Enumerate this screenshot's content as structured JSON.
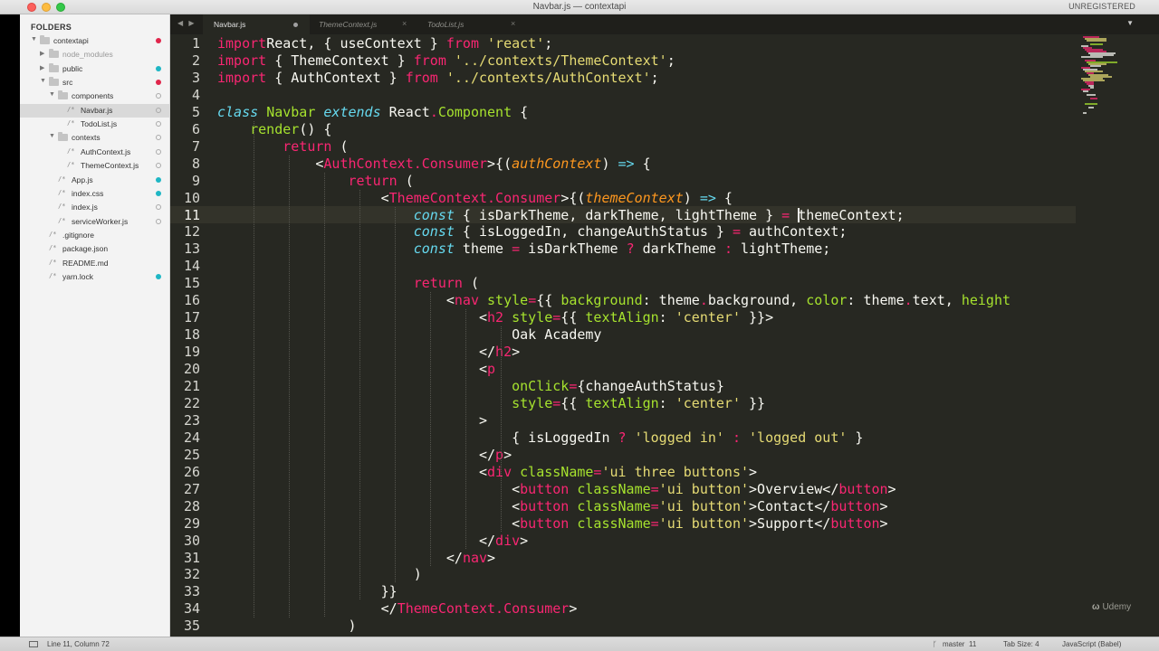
{
  "window": {
    "title": "Navbar.js — contextapi",
    "license_status": "UNREGISTERED"
  },
  "sidebar": {
    "heading": "FOLDERS",
    "items": [
      {
        "label": "contextapi",
        "type": "folder",
        "depth": 0,
        "status": "modified"
      },
      {
        "label": "node_modules",
        "type": "folder",
        "depth": 1,
        "status": "none",
        "muted": true
      },
      {
        "label": "public",
        "type": "folder",
        "depth": 1,
        "status": "new"
      },
      {
        "label": "src",
        "type": "folder",
        "depth": 1,
        "status": "modified"
      },
      {
        "label": "components",
        "type": "folder",
        "depth": 2,
        "status": "unchanged"
      },
      {
        "label": "Navbar.js",
        "type": "file",
        "depth": 3,
        "status": "unchanged",
        "selected": true
      },
      {
        "label": "TodoList.js",
        "type": "file",
        "depth": 3,
        "status": "unchanged"
      },
      {
        "label": "contexts",
        "type": "folder",
        "depth": 2,
        "status": "unchanged"
      },
      {
        "label": "AuthContext.js",
        "type": "file",
        "depth": 3,
        "status": "unchanged"
      },
      {
        "label": "ThemeContext.js",
        "type": "file",
        "depth": 3,
        "status": "unchanged"
      },
      {
        "label": "App.js",
        "type": "file",
        "depth": 2,
        "status": "new"
      },
      {
        "label": "index.css",
        "type": "file",
        "depth": 2,
        "status": "new"
      },
      {
        "label": "index.js",
        "type": "file",
        "depth": 2,
        "status": "unchanged"
      },
      {
        "label": "serviceWorker.js",
        "type": "file",
        "depth": 2,
        "status": "unchanged"
      },
      {
        "label": ".gitignore",
        "type": "file",
        "depth": 1,
        "status": "none"
      },
      {
        "label": "package.json",
        "type": "file",
        "depth": 1,
        "status": "none"
      },
      {
        "label": "README.md",
        "type": "file",
        "depth": 1,
        "status": "none"
      },
      {
        "label": "yarn.lock",
        "type": "file",
        "depth": 1,
        "status": "new"
      }
    ]
  },
  "tabs": [
    {
      "label": "Navbar.js",
      "active": true,
      "dirty": true,
      "close": "×"
    },
    {
      "label": "ThemeContext.js",
      "active": false,
      "dirty": false,
      "close": "×"
    },
    {
      "label": "TodoList.js",
      "active": false,
      "dirty": false,
      "close": "×"
    }
  ],
  "tab_nav": "◀ ▶",
  "tab_menu": "▼",
  "editor": {
    "current_line": 11,
    "lines": [
      {
        "n": "1",
        "segs": [
          [
            "kw",
            "import"
          ],
          [
            "",
            "React, { useContext } "
          ],
          [
            "kw",
            "from"
          ],
          [
            "",
            " "
          ],
          [
            "st",
            "'react'"
          ],
          [
            "",
            ";"
          ]
        ]
      },
      {
        "n": "2",
        "segs": [
          [
            "kw",
            "import"
          ],
          [
            "",
            " { ThemeContext } "
          ],
          [
            "kw",
            "from"
          ],
          [
            "",
            " "
          ],
          [
            "st",
            "'../contexts/ThemeContext'"
          ],
          [
            "",
            ";"
          ]
        ]
      },
      {
        "n": "3",
        "segs": [
          [
            "kw",
            "import"
          ],
          [
            "",
            " { AuthContext } "
          ],
          [
            "kw",
            "from"
          ],
          [
            "",
            " "
          ],
          [
            "st",
            "'../contexts/AuthContext'"
          ],
          [
            "",
            ";"
          ]
        ]
      },
      {
        "n": "4",
        "segs": []
      },
      {
        "n": "5",
        "segs": [
          [
            "kw2",
            "class"
          ],
          [
            "",
            " "
          ],
          [
            "ty",
            "Navbar"
          ],
          [
            "",
            " "
          ],
          [
            "kw2",
            "extends"
          ],
          [
            "",
            " React"
          ],
          [
            "op",
            "."
          ],
          [
            "ty",
            "Component"
          ],
          [
            "",
            " {"
          ]
        ]
      },
      {
        "n": "6",
        "segs": [
          [
            "",
            "    "
          ],
          [
            "fn",
            "render"
          ],
          [
            "",
            "() {"
          ]
        ]
      },
      {
        "n": "7",
        "segs": [
          [
            "",
            "        "
          ],
          [
            "kw",
            "return"
          ],
          [
            "",
            " ("
          ]
        ]
      },
      {
        "n": "8",
        "segs": [
          [
            "",
            "            <"
          ],
          [
            "tag",
            "AuthContext.Consumer"
          ],
          [
            "",
            ">{("
          ],
          [
            "par",
            "authContext"
          ],
          [
            "",
            ") "
          ],
          [
            "kw2",
            "=>"
          ],
          [
            "",
            " {"
          ]
        ]
      },
      {
        "n": "9",
        "segs": [
          [
            "",
            "                "
          ],
          [
            "kw",
            "return"
          ],
          [
            "",
            " ("
          ]
        ]
      },
      {
        "n": "10",
        "segs": [
          [
            "",
            "                    <"
          ],
          [
            "tag",
            "ThemeContext.Consumer"
          ],
          [
            "",
            ">{("
          ],
          [
            "par",
            "themeContext"
          ],
          [
            "",
            ") "
          ],
          [
            "kw2",
            "=>"
          ],
          [
            "",
            " {"
          ]
        ]
      },
      {
        "n": "11",
        "segs": [
          [
            "",
            "                        "
          ],
          [
            "kw2",
            "const"
          ],
          [
            "",
            " { isDarkTheme, darkTheme, lightTheme } "
          ],
          [
            "op",
            "="
          ],
          [
            "",
            " "
          ],
          [
            "caret",
            ""
          ],
          [
            "",
            "themeContext;"
          ]
        ]
      },
      {
        "n": "12",
        "segs": [
          [
            "",
            "                        "
          ],
          [
            "kw2",
            "const"
          ],
          [
            "",
            " { isLoggedIn, changeAuthStatus } "
          ],
          [
            "op",
            "="
          ],
          [
            "",
            " authContext;"
          ]
        ]
      },
      {
        "n": "13",
        "segs": [
          [
            "",
            "                        "
          ],
          [
            "kw2",
            "const"
          ],
          [
            "",
            " theme "
          ],
          [
            "op",
            "="
          ],
          [
            "",
            " isDarkTheme "
          ],
          [
            "op",
            "?"
          ],
          [
            "",
            " darkTheme "
          ],
          [
            "op",
            ":"
          ],
          [
            "",
            " lightTheme;"
          ]
        ]
      },
      {
        "n": "14",
        "segs": []
      },
      {
        "n": "15",
        "segs": [
          [
            "",
            "                        "
          ],
          [
            "kw",
            "return"
          ],
          [
            "",
            " ("
          ]
        ]
      },
      {
        "n": "16",
        "segs": [
          [
            "",
            "                            <"
          ],
          [
            "tag",
            "nav"
          ],
          [
            "",
            " "
          ],
          [
            "fn",
            "style"
          ],
          [
            "op",
            "="
          ],
          [
            "",
            "{{ "
          ],
          [
            "fn",
            "background"
          ],
          [
            "",
            ": theme"
          ],
          [
            "op",
            "."
          ],
          [
            "",
            "background, "
          ],
          [
            "fn",
            "color"
          ],
          [
            "",
            ": theme"
          ],
          [
            "op",
            "."
          ],
          [
            "",
            "text, "
          ],
          [
            "fn",
            "height"
          ]
        ]
      },
      {
        "n": "17",
        "segs": [
          [
            "",
            "                                <"
          ],
          [
            "tag",
            "h2"
          ],
          [
            "",
            " "
          ],
          [
            "fn",
            "style"
          ],
          [
            "op",
            "="
          ],
          [
            "",
            "{{ "
          ],
          [
            "fn",
            "textAlign"
          ],
          [
            "",
            ": "
          ],
          [
            "st",
            "'center'"
          ],
          [
            "",
            " }}>"
          ]
        ]
      },
      {
        "n": "18",
        "segs": [
          [
            "",
            "                                    Oak Academy"
          ]
        ]
      },
      {
        "n": "19",
        "segs": [
          [
            "",
            "                                </"
          ],
          [
            "tag",
            "h2"
          ],
          [
            "",
            ">"
          ]
        ]
      },
      {
        "n": "20",
        "segs": [
          [
            "",
            "                                <"
          ],
          [
            "tag",
            "p"
          ]
        ]
      },
      {
        "n": "21",
        "segs": [
          [
            "",
            "                                    "
          ],
          [
            "fn",
            "onClick"
          ],
          [
            "op",
            "="
          ],
          [
            "",
            "{changeAuthStatus}"
          ]
        ]
      },
      {
        "n": "22",
        "segs": [
          [
            "",
            "                                    "
          ],
          [
            "fn",
            "style"
          ],
          [
            "op",
            "="
          ],
          [
            "",
            "{{ "
          ],
          [
            "fn",
            "textAlign"
          ],
          [
            "",
            ": "
          ],
          [
            "st",
            "'center'"
          ],
          [
            "",
            " }}"
          ]
        ]
      },
      {
        "n": "23",
        "segs": [
          [
            "",
            "                                >"
          ]
        ]
      },
      {
        "n": "24",
        "segs": [
          [
            "",
            "                                    { isLoggedIn "
          ],
          [
            "op",
            "?"
          ],
          [
            "",
            " "
          ],
          [
            "st",
            "'logged in'"
          ],
          [
            "",
            " "
          ],
          [
            "op",
            ":"
          ],
          [
            "",
            " "
          ],
          [
            "st",
            "'logged out'"
          ],
          [
            "",
            " }"
          ]
        ]
      },
      {
        "n": "25",
        "segs": [
          [
            "",
            "                                </"
          ],
          [
            "tag",
            "p"
          ],
          [
            "",
            ">"
          ]
        ]
      },
      {
        "n": "26",
        "segs": [
          [
            "",
            "                                <"
          ],
          [
            "tag",
            "div"
          ],
          [
            "",
            " "
          ],
          [
            "fn",
            "className"
          ],
          [
            "op",
            "="
          ],
          [
            "st",
            "'ui three buttons'"
          ],
          [
            "",
            ">"
          ]
        ]
      },
      {
        "n": "27",
        "segs": [
          [
            "",
            "                                    <"
          ],
          [
            "tag",
            "button"
          ],
          [
            "",
            " "
          ],
          [
            "fn",
            "className"
          ],
          [
            "op",
            "="
          ],
          [
            "st",
            "'ui button'"
          ],
          [
            "",
            ">Overview</"
          ],
          [
            "tag",
            "button"
          ],
          [
            "",
            ">"
          ]
        ]
      },
      {
        "n": "28",
        "segs": [
          [
            "",
            "                                    <"
          ],
          [
            "tag",
            "button"
          ],
          [
            "",
            " "
          ],
          [
            "fn",
            "className"
          ],
          [
            "op",
            "="
          ],
          [
            "st",
            "'ui button'"
          ],
          [
            "",
            ">Contact</"
          ],
          [
            "tag",
            "button"
          ],
          [
            "",
            ">"
          ]
        ]
      },
      {
        "n": "29",
        "segs": [
          [
            "",
            "                                    <"
          ],
          [
            "tag",
            "button"
          ],
          [
            "",
            " "
          ],
          [
            "fn",
            "className"
          ],
          [
            "op",
            "="
          ],
          [
            "st",
            "'ui button'"
          ],
          [
            "",
            ">Support</"
          ],
          [
            "tag",
            "button"
          ],
          [
            "",
            ">"
          ]
        ]
      },
      {
        "n": "30",
        "segs": [
          [
            "",
            "                                </"
          ],
          [
            "tag",
            "div"
          ],
          [
            "",
            ">"
          ]
        ]
      },
      {
        "n": "31",
        "segs": [
          [
            "",
            "                            </"
          ],
          [
            "tag",
            "nav"
          ],
          [
            "",
            ">"
          ]
        ]
      },
      {
        "n": "32",
        "segs": [
          [
            "",
            "                        )"
          ]
        ]
      },
      {
        "n": "33",
        "segs": [
          [
            "",
            "                    }}"
          ]
        ]
      },
      {
        "n": "34",
        "segs": [
          [
            "",
            "                    </"
          ],
          [
            "tag",
            "ThemeContext.Consumer"
          ],
          [
            "",
            ">"
          ]
        ]
      },
      {
        "n": "35",
        "segs": [
          [
            "",
            "                )"
          ]
        ]
      }
    ]
  },
  "statusbar": {
    "position": "Line 11, Column 72",
    "branch": "master",
    "branch_count": "11",
    "tab_size": "Tab Size: 4",
    "syntax": "JavaScript (Babel)"
  },
  "watermark": "Udemy",
  "colors": {
    "editor_bg": "#272822",
    "keyword": "#f92672",
    "string": "#e6db74",
    "type": "#a6e22e",
    "storage": "#66d9ef",
    "param": "#fd971f"
  }
}
